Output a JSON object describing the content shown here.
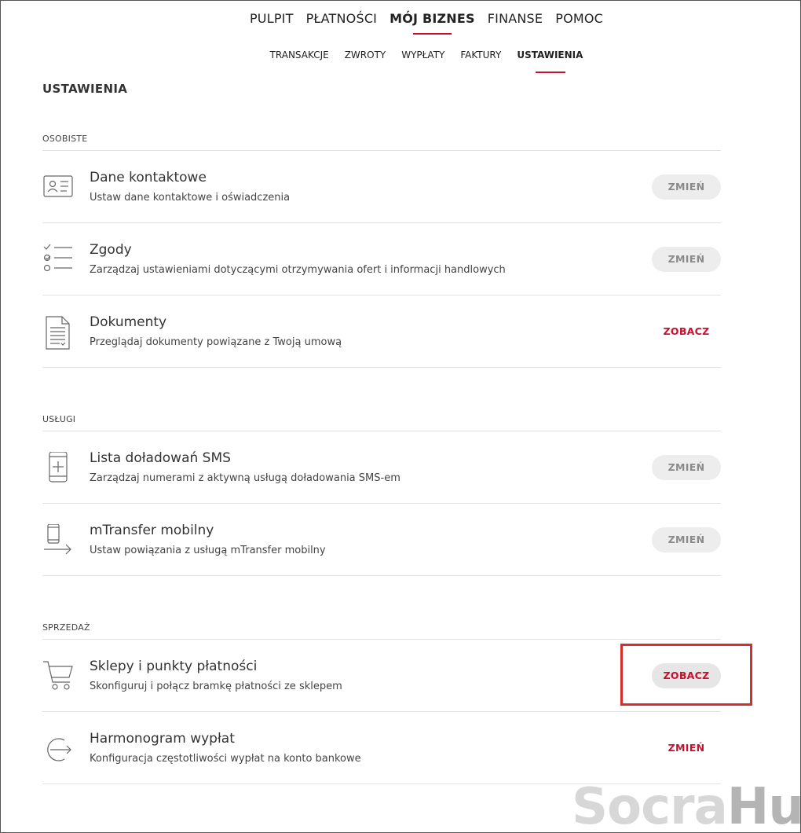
{
  "nav": {
    "main": [
      "PULPIT",
      "PŁATNOŚCI",
      "MÓJ BIZNES",
      "FINANSE",
      "POMOC"
    ],
    "main_active": "MÓJ BIZNES",
    "sub": [
      "TRANSAKCJE",
      "ZWROTY",
      "WYPŁATY",
      "FAKTURY",
      "USTAWIENIA"
    ],
    "sub_active": "USTAWIENIA"
  },
  "page_title": "USTAWIENIA",
  "sections": [
    {
      "label": "OSOBISTE",
      "items": [
        {
          "icon": "contact-card-icon",
          "title": "Dane kontaktowe",
          "desc": "Ustaw dane kontaktowe i oświadczenia",
          "action": "ZMIEŃ"
        },
        {
          "icon": "checklist-icon",
          "title": "Zgody",
          "desc": "Zarządzaj ustawieniami dotyczącymi otrzymywania ofert i informacji handlowych",
          "action": "ZMIEŃ"
        },
        {
          "icon": "document-icon",
          "title": "Dokumenty",
          "desc": "Przeglądaj dokumenty powiązane z Twoją umową",
          "action": "ZOBACZ"
        }
      ]
    },
    {
      "label": "USŁUGI",
      "items": [
        {
          "icon": "phone-topup-icon",
          "title": "Lista doładowań SMS",
          "desc": "Zarządzaj numerami z aktywną usługą doładowania SMS-em",
          "action": "ZMIEŃ"
        },
        {
          "icon": "phone-transfer-icon",
          "title": "mTransfer mobilny",
          "desc": "Ustaw powiązania z usługą mTransfer mobilny",
          "action": "ZMIEŃ"
        }
      ]
    },
    {
      "label": "SPRZEDAŻ",
      "items": [
        {
          "icon": "shopping-cart-icon",
          "title": "Sklepy i punkty płatności",
          "desc": "Skonfiguruj i połącz bramkę płatności ze sklepem",
          "action": "ZOBACZ"
        },
        {
          "icon": "payout-schedule-icon",
          "title": "Harmonogram wypłat",
          "desc": "Konfiguracja częstotliwości wypłat na konto bankowe",
          "action": "ZMIEŃ"
        }
      ]
    }
  ],
  "watermark": {
    "part1": "Socra",
    "part2": "Hub"
  },
  "colors": {
    "accent": "#c8102e",
    "highlight": "#d32f2f",
    "button_gray": "#ededed"
  }
}
